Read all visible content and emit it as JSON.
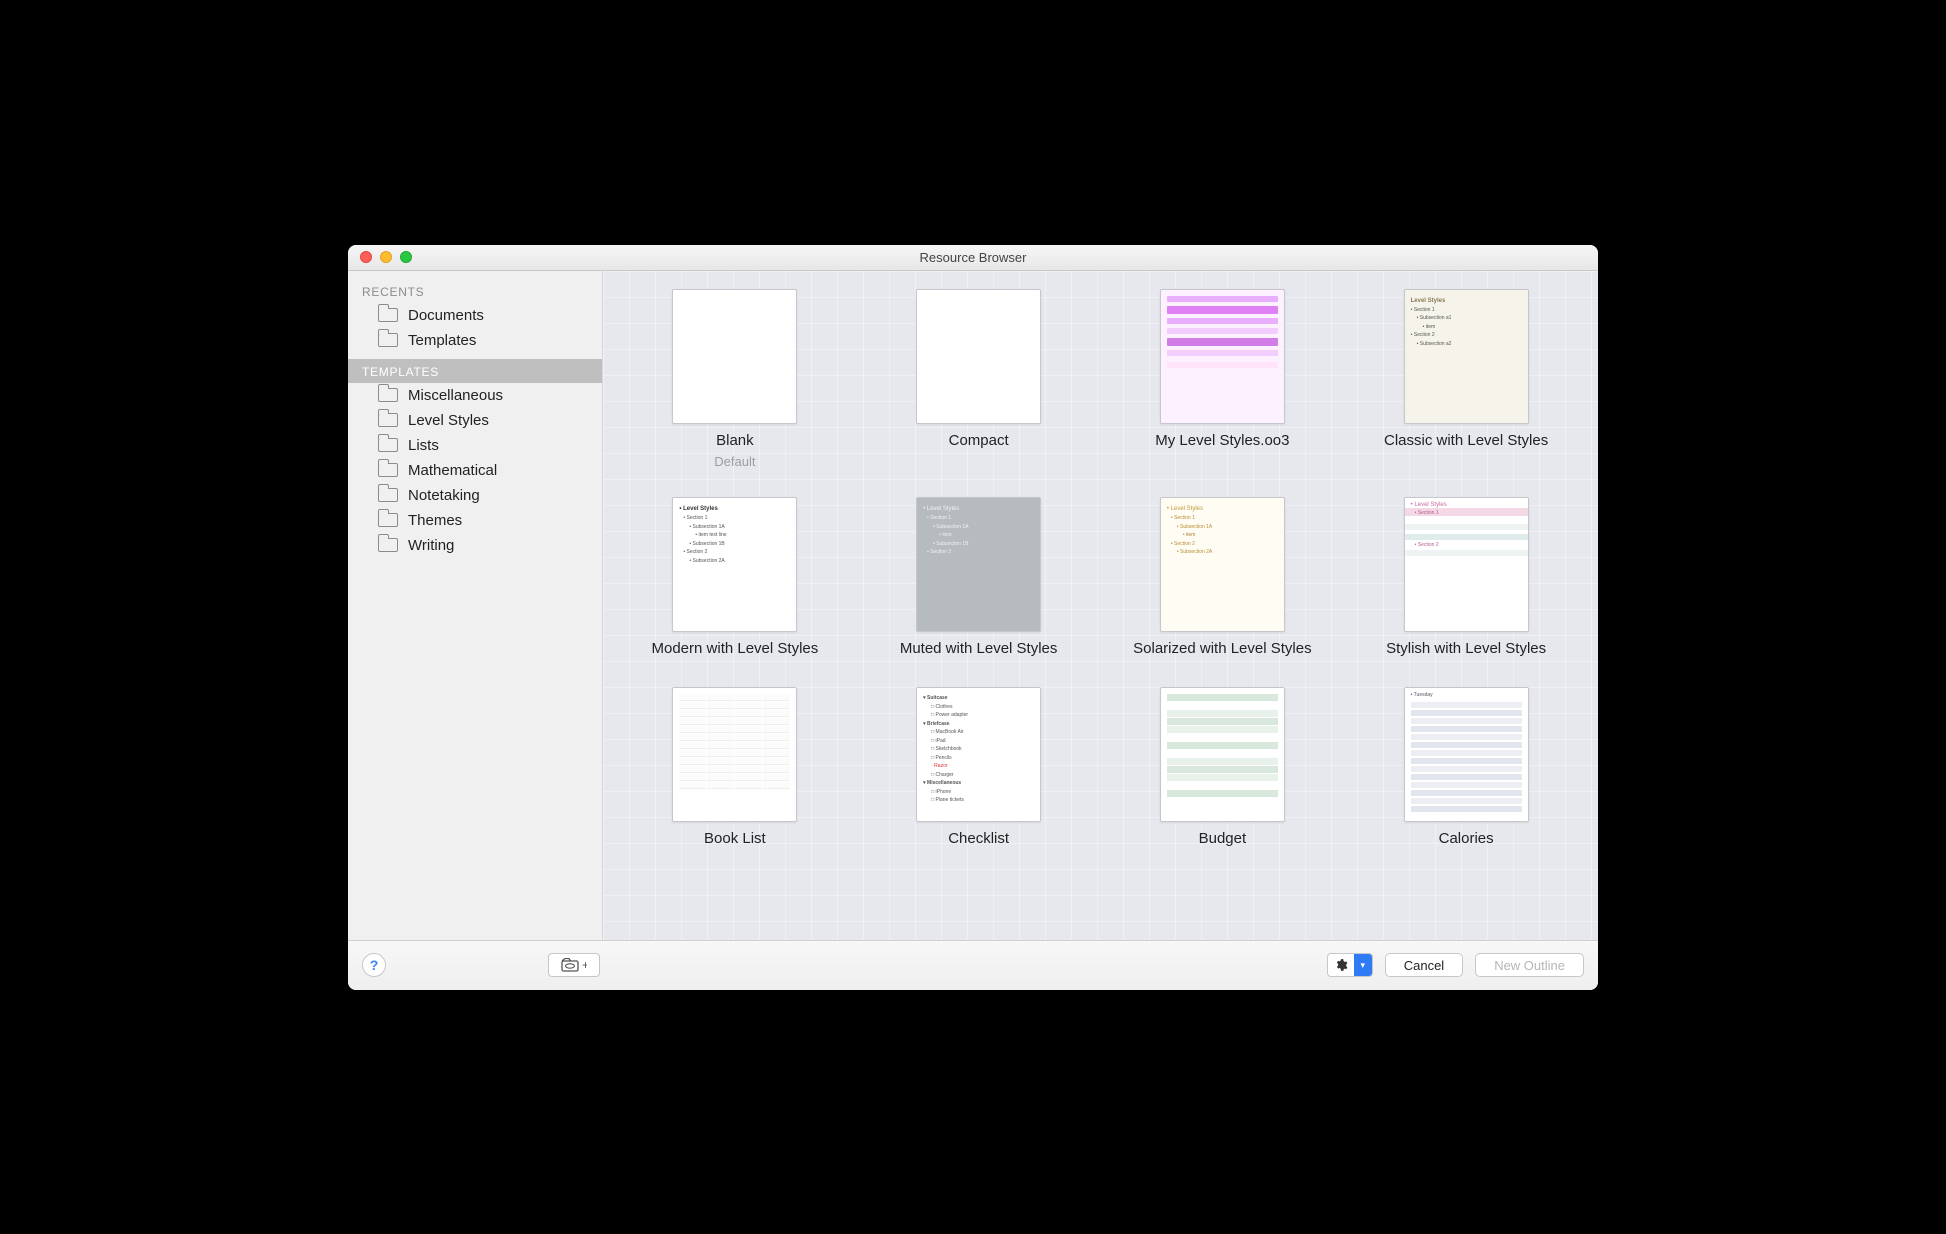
{
  "window": {
    "title": "Resource Browser"
  },
  "sidebar": {
    "recents_header": "RECENTS",
    "recents": [
      {
        "label": "Documents"
      },
      {
        "label": "Templates"
      }
    ],
    "templates_header": "TEMPLATES",
    "categories": [
      {
        "label": "Miscellaneous"
      },
      {
        "label": "Level Styles"
      },
      {
        "label": "Lists"
      },
      {
        "label": "Mathematical"
      },
      {
        "label": "Notetaking"
      },
      {
        "label": "Themes"
      },
      {
        "label": "Writing"
      }
    ]
  },
  "templates": [
    {
      "name": "Blank",
      "subtitle": "Default",
      "variant": "blank"
    },
    {
      "name": "Compact",
      "variant": "blank"
    },
    {
      "name": "My Level Styles.oo3",
      "variant": "pink"
    },
    {
      "name": "Classic with Level Styles",
      "variant": "beige"
    },
    {
      "name": "Modern with Level Styles",
      "variant": "lines"
    },
    {
      "name": "Muted with Level Styles",
      "variant": "muted"
    },
    {
      "name": "Solarized with Level Styles",
      "variant": "solar"
    },
    {
      "name": "Stylish with Level Styles",
      "variant": "stylish"
    },
    {
      "name": "Book List",
      "variant": "table"
    },
    {
      "name": "Checklist",
      "variant": "check"
    },
    {
      "name": "Budget",
      "variant": "budget"
    },
    {
      "name": "Calories",
      "variant": "cal"
    }
  ],
  "footer": {
    "cancel": "Cancel",
    "new_outline": "New Outline"
  }
}
